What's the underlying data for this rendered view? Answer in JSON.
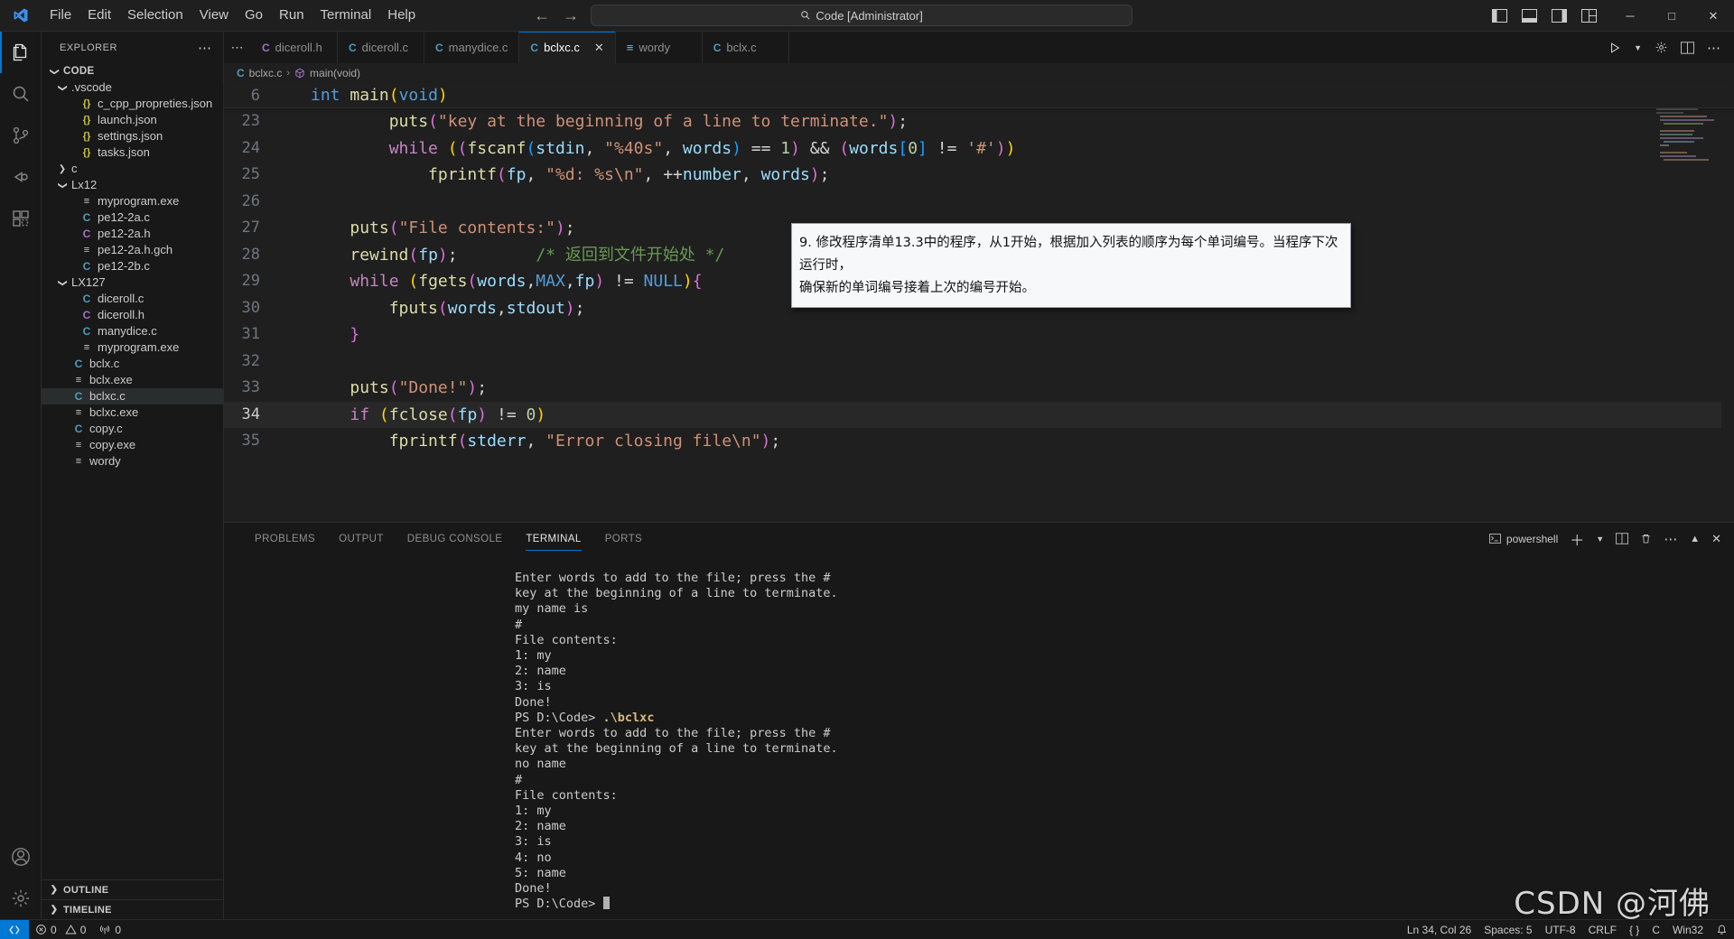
{
  "titlebar": {
    "menu": [
      "File",
      "Edit",
      "Selection",
      "View",
      "Go",
      "Run",
      "Terminal",
      "Help"
    ],
    "command_center_text": "Code [Administrator]",
    "search_icon": "search-icon",
    "back_arrow": "←",
    "forward_arrow": "→",
    "minimize": "─",
    "maximize": "□",
    "close": "✕"
  },
  "activitybar": {
    "items": [
      {
        "name": "explorer",
        "label": "Explorer"
      },
      {
        "name": "search",
        "label": "Search"
      },
      {
        "name": "source-control",
        "label": "Source Control"
      },
      {
        "name": "run-and-debug",
        "label": "Run and Debug"
      },
      {
        "name": "extensions",
        "label": "Extensions"
      }
    ],
    "bottom": [
      {
        "name": "accounts",
        "label": "Accounts"
      },
      {
        "name": "settings",
        "label": "Manage"
      }
    ]
  },
  "sidebar": {
    "title": "EXPLORER",
    "more_actions": "⋯",
    "tree": [
      {
        "label": "CODE",
        "kind": "folder-root",
        "depth": 0,
        "expanded": true
      },
      {
        "label": ".vscode",
        "kind": "folder",
        "depth": 1,
        "expanded": true
      },
      {
        "label": "c_cpp_propreties.json",
        "kind": "json",
        "depth": 2
      },
      {
        "label": "launch.json",
        "kind": "json",
        "depth": 2
      },
      {
        "label": "settings.json",
        "kind": "json",
        "depth": 2
      },
      {
        "label": "tasks.json",
        "kind": "json",
        "depth": 2
      },
      {
        "label": "c",
        "kind": "folder",
        "depth": 1,
        "expanded": false
      },
      {
        "label": "Lx12",
        "kind": "folder",
        "depth": 1,
        "expanded": true
      },
      {
        "label": "myprogram.exe",
        "kind": "exe",
        "depth": 2
      },
      {
        "label": "pe12-2a.c",
        "kind": "c",
        "depth": 2
      },
      {
        "label": "pe12-2a.h",
        "kind": "h",
        "depth": 2
      },
      {
        "label": "pe12-2a.h.gch",
        "kind": "exe",
        "depth": 2
      },
      {
        "label": "pe12-2b.c",
        "kind": "c",
        "depth": 2
      },
      {
        "label": "LX127",
        "kind": "folder",
        "depth": 1,
        "expanded": true
      },
      {
        "label": "diceroll.c",
        "kind": "c",
        "depth": 2
      },
      {
        "label": "diceroll.h",
        "kind": "h",
        "depth": 2
      },
      {
        "label": "manydice.c",
        "kind": "c",
        "depth": 2
      },
      {
        "label": "myprogram.exe",
        "kind": "exe",
        "depth": 2
      },
      {
        "label": "bclx.c",
        "kind": "c",
        "depth": 1
      },
      {
        "label": "bclx.exe",
        "kind": "exe",
        "depth": 1
      },
      {
        "label": "bclxc.c",
        "kind": "c",
        "depth": 1,
        "selected": true
      },
      {
        "label": "bclxc.exe",
        "kind": "exe",
        "depth": 1
      },
      {
        "label": "copy.c",
        "kind": "c",
        "depth": 1
      },
      {
        "label": "copy.exe",
        "kind": "exe",
        "depth": 1
      },
      {
        "label": "wordy",
        "kind": "exe",
        "depth": 1
      }
    ],
    "sections": [
      {
        "label": "OUTLINE",
        "expanded": false
      },
      {
        "label": "TIMELINE",
        "expanded": false
      }
    ]
  },
  "editor": {
    "tab_overflow": "⋯",
    "tabs": [
      {
        "label": "diceroll.h",
        "icon": "h",
        "active": false,
        "dirty": false
      },
      {
        "label": "diceroll.c",
        "icon": "c",
        "active": false,
        "dirty": false
      },
      {
        "label": "manydice.c",
        "icon": "c",
        "active": false,
        "dirty": false
      },
      {
        "label": "bclxc.c",
        "icon": "c",
        "active": true,
        "dirty": false,
        "close": "✕"
      },
      {
        "label": "wordy",
        "icon": "file",
        "active": false,
        "dirty": false
      },
      {
        "label": "bclx.c",
        "icon": "c",
        "active": false,
        "dirty": false
      }
    ],
    "actions": [
      "run-button",
      "chevron-down-icon",
      "gear-icon",
      "split-editor-icon",
      "more-actions-icon"
    ],
    "breadcrumb": {
      "file_icon": "c",
      "file": "bclxc.c",
      "separator": "›",
      "symbol_icon": "method-icon",
      "symbol": "main(void)"
    },
    "sticky_scroll": {
      "line": "6",
      "code": "int main(void)"
    },
    "lines": [
      {
        "no": "23",
        "current": false,
        "tokens": [
          {
            "t": "        ",
            "c": "op"
          },
          {
            "t": "puts",
            "c": "fn"
          },
          {
            "t": "(",
            "c": "p2"
          },
          {
            "t": "\"key at the beginning of a line to terminate.\"",
            "c": "str"
          },
          {
            "t": ")",
            "c": "p2"
          },
          {
            "t": ";",
            "c": "op"
          }
        ]
      },
      {
        "no": "24",
        "current": false,
        "tokens": [
          {
            "t": "        ",
            "c": "op"
          },
          {
            "t": "while",
            "c": "kw"
          },
          {
            "t": " ",
            "c": "op"
          },
          {
            "t": "(",
            "c": "p1"
          },
          {
            "t": "(",
            "c": "p2"
          },
          {
            "t": "fscanf",
            "c": "fn"
          },
          {
            "t": "(",
            "c": "p3"
          },
          {
            "t": "stdin",
            "c": "var"
          },
          {
            "t": ", ",
            "c": "op"
          },
          {
            "t": "\"%40s\"",
            "c": "str"
          },
          {
            "t": ", ",
            "c": "op"
          },
          {
            "t": "words",
            "c": "var"
          },
          {
            "t": ")",
            "c": "p3"
          },
          {
            "t": " == ",
            "c": "op"
          },
          {
            "t": "1",
            "c": "num"
          },
          {
            "t": ")",
            "c": "p2"
          },
          {
            "t": " && ",
            "c": "op"
          },
          {
            "t": "(",
            "c": "p2"
          },
          {
            "t": "words",
            "c": "var"
          },
          {
            "t": "[",
            "c": "p3"
          },
          {
            "t": "0",
            "c": "num"
          },
          {
            "t": "]",
            "c": "p3"
          },
          {
            "t": " != ",
            "c": "op"
          },
          {
            "t": "'#'",
            "c": "str"
          },
          {
            "t": ")",
            "c": "p2"
          },
          {
            "t": ")",
            "c": "p1"
          }
        ]
      },
      {
        "no": "25",
        "current": false,
        "tokens": [
          {
            "t": "            ",
            "c": "op"
          },
          {
            "t": "fprintf",
            "c": "fn"
          },
          {
            "t": "(",
            "c": "p2"
          },
          {
            "t": "fp",
            "c": "var"
          },
          {
            "t": ", ",
            "c": "op"
          },
          {
            "t": "\"%d: %s\\n\"",
            "c": "str"
          },
          {
            "t": ", ",
            "c": "op"
          },
          {
            "t": "++",
            "c": "op"
          },
          {
            "t": "number",
            "c": "var"
          },
          {
            "t": ", ",
            "c": "op"
          },
          {
            "t": "words",
            "c": "var"
          },
          {
            "t": ")",
            "c": "p2"
          },
          {
            "t": ";",
            "c": "op"
          }
        ]
      },
      {
        "no": "26",
        "current": false,
        "tokens": []
      },
      {
        "no": "27",
        "current": false,
        "tokens": [
          {
            "t": "    ",
            "c": "op"
          },
          {
            "t": "puts",
            "c": "fn"
          },
          {
            "t": "(",
            "c": "p2"
          },
          {
            "t": "\"File contents:\"",
            "c": "str"
          },
          {
            "t": ")",
            "c": "p2"
          },
          {
            "t": ";",
            "c": "op"
          }
        ]
      },
      {
        "no": "28",
        "current": false,
        "tokens": [
          {
            "t": "    ",
            "c": "op"
          },
          {
            "t": "rewind",
            "c": "fn"
          },
          {
            "t": "(",
            "c": "p2"
          },
          {
            "t": "fp",
            "c": "var"
          },
          {
            "t": ")",
            "c": "p2"
          },
          {
            "t": ";",
            "c": "op"
          },
          {
            "t": "        ",
            "c": "op"
          },
          {
            "t": "/* 返回到文件开始处 */",
            "c": "cmt"
          }
        ]
      },
      {
        "no": "29",
        "current": false,
        "tokens": [
          {
            "t": "    ",
            "c": "op"
          },
          {
            "t": "while",
            "c": "kw"
          },
          {
            "t": " ",
            "c": "op"
          },
          {
            "t": "(",
            "c": "p1"
          },
          {
            "t": "fgets",
            "c": "fn"
          },
          {
            "t": "(",
            "c": "p2"
          },
          {
            "t": "words",
            "c": "var"
          },
          {
            "t": ",",
            "c": "op"
          },
          {
            "t": "MAX",
            "c": "cnst"
          },
          {
            "t": ",",
            "c": "op"
          },
          {
            "t": "fp",
            "c": "var"
          },
          {
            "t": ")",
            "c": "p2"
          },
          {
            "t": " != ",
            "c": "op"
          },
          {
            "t": "NULL",
            "c": "cnst"
          },
          {
            "t": ")",
            "c": "p1"
          },
          {
            "t": "{",
            "c": "p2"
          }
        ]
      },
      {
        "no": "30",
        "current": false,
        "tokens": [
          {
            "t": "        ",
            "c": "op"
          },
          {
            "t": "fputs",
            "c": "fn"
          },
          {
            "t": "(",
            "c": "p2"
          },
          {
            "t": "words",
            "c": "var"
          },
          {
            "t": ",",
            "c": "op"
          },
          {
            "t": "stdout",
            "c": "var"
          },
          {
            "t": ")",
            "c": "p2"
          },
          {
            "t": ";",
            "c": "op"
          }
        ]
      },
      {
        "no": "31",
        "current": false,
        "tokens": [
          {
            "t": "    ",
            "c": "op"
          },
          {
            "t": "}",
            "c": "p2"
          }
        ]
      },
      {
        "no": "32",
        "current": false,
        "tokens": []
      },
      {
        "no": "33",
        "current": false,
        "tokens": [
          {
            "t": "    ",
            "c": "op"
          },
          {
            "t": "puts",
            "c": "fn"
          },
          {
            "t": "(",
            "c": "p2"
          },
          {
            "t": "\"Done!\"",
            "c": "str"
          },
          {
            "t": ")",
            "c": "p2"
          },
          {
            "t": ";",
            "c": "op"
          }
        ]
      },
      {
        "no": "34",
        "current": true,
        "tokens": [
          {
            "t": "    ",
            "c": "op"
          },
          {
            "t": "if",
            "c": "kw"
          },
          {
            "t": " ",
            "c": "op"
          },
          {
            "t": "(",
            "c": "p1"
          },
          {
            "t": "fclose",
            "c": "fn"
          },
          {
            "t": "(",
            "c": "p2"
          },
          {
            "t": "fp",
            "c": "var"
          },
          {
            "t": ")",
            "c": "p2"
          },
          {
            "t": " != ",
            "c": "op"
          },
          {
            "t": "0",
            "c": "num"
          },
          {
            "t": ")",
            "c": "p1"
          }
        ]
      },
      {
        "no": "35",
        "current": false,
        "tokens": [
          {
            "t": "        ",
            "c": "op"
          },
          {
            "t": "fprintf",
            "c": "fn"
          },
          {
            "t": "(",
            "c": "p2"
          },
          {
            "t": "stderr",
            "c": "var"
          },
          {
            "t": ", ",
            "c": "op"
          },
          {
            "t": "\"Error closing file\\n\"",
            "c": "str"
          },
          {
            "t": ")",
            "c": "p2"
          },
          {
            "t": ";",
            "c": "op"
          }
        ]
      }
    ]
  },
  "annotation": {
    "line1": "9. 修改程序清单13.3中的程序，从1开始，根据加入列表的顺序为每个单词编号。当程序下次运行时，",
    "line2": "确保新的单词编号接着上次的编号开始。"
  },
  "panel": {
    "tabs": [
      "PROBLEMS",
      "OUTPUT",
      "DEBUG CONSOLE",
      "TERMINAL",
      "PORTS"
    ],
    "active_tab": "TERMINAL",
    "shell_name": "powershell",
    "actions": [
      "new-terminal-icon",
      "chevron-down-icon",
      "split-terminal-icon",
      "kill-terminal-icon",
      "more-actions-icon",
      "maximize-panel-icon",
      "close-panel-icon"
    ],
    "terminal_lines": [
      {
        "text": "Enter words to add to the file; press the #",
        "kind": "out"
      },
      {
        "text": "key at the beginning of a line to terminate.",
        "kind": "out"
      },
      {
        "text": "my name is",
        "kind": "out"
      },
      {
        "text": "#",
        "kind": "out"
      },
      {
        "text": "File contents:",
        "kind": "out"
      },
      {
        "text": "1: my",
        "kind": "out"
      },
      {
        "text": "2: name",
        "kind": "out"
      },
      {
        "text": "3: is",
        "kind": "out"
      },
      {
        "text": "Done!",
        "kind": "out"
      },
      {
        "prompt": "PS D:\\Code> ",
        "cmd": ".\\bclxc",
        "kind": "prompt"
      },
      {
        "text": "Enter words to add to the file; press the #",
        "kind": "out"
      },
      {
        "text": "key at the beginning of a line to terminate.",
        "kind": "out"
      },
      {
        "text": "no name",
        "kind": "out"
      },
      {
        "text": "#",
        "kind": "out"
      },
      {
        "text": "File contents:",
        "kind": "out"
      },
      {
        "text": "1: my",
        "kind": "out"
      },
      {
        "text": "2: name",
        "kind": "out"
      },
      {
        "text": "3: is",
        "kind": "out"
      },
      {
        "text": "4: no",
        "kind": "out"
      },
      {
        "text": "5: name",
        "kind": "out"
      },
      {
        "text": "Done!",
        "kind": "out"
      },
      {
        "prompt": "PS D:\\Code> ",
        "cmd": "",
        "kind": "prompt-caret"
      }
    ]
  },
  "watermark": "CSDN @河佛",
  "statusbar": {
    "remote_icon": "remote-indicator-icon",
    "errors": "0",
    "warnings": "0",
    "ports": "0",
    "cursor_position": "Ln 34, Col 26",
    "indentation": "Spaces: 5",
    "encoding": "UTF-8",
    "eol": "CRLF",
    "format": "{ }",
    "language": "C",
    "platform": "Win32",
    "bell": "notifications-icon"
  }
}
